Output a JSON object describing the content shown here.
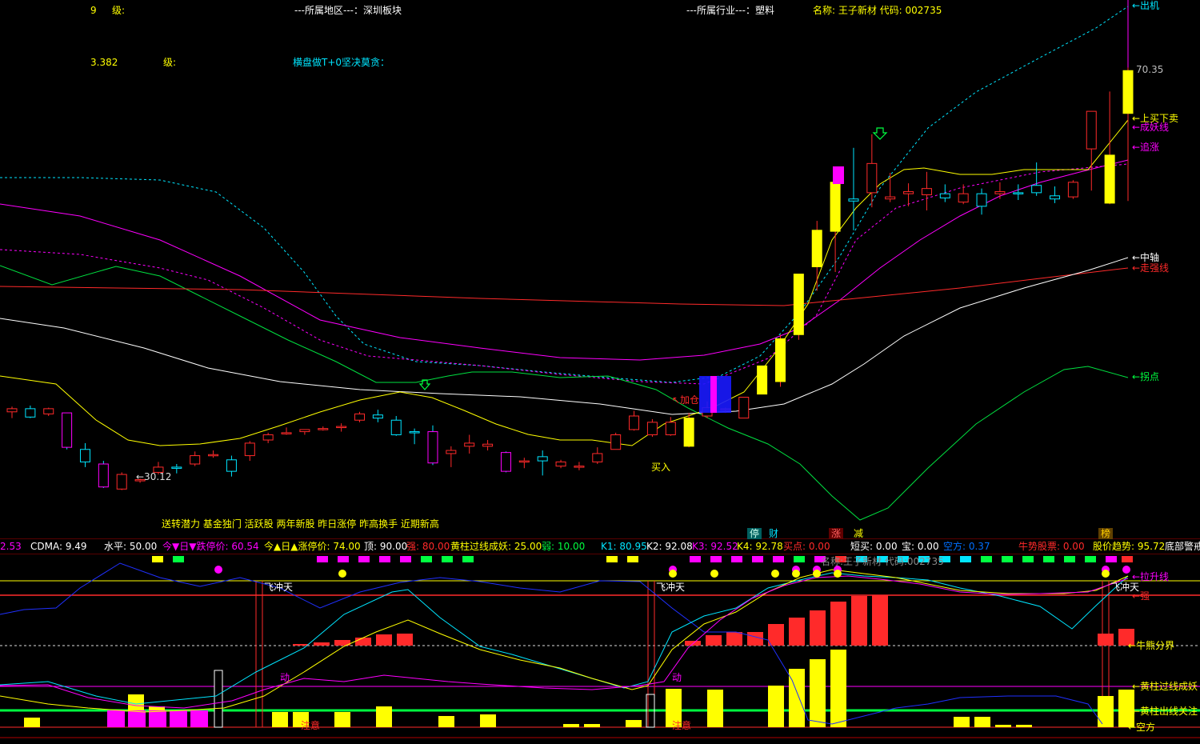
{
  "header": {
    "level1": "9",
    "level1_unit": "级:",
    "region": "---所属地区---：深圳板块",
    "industry": "---所属行业---：塑料",
    "stock_label": "名称: 王子新材 代码: 002735",
    "level2": "3.382",
    "level2_unit": "级:",
    "slogan": "横盘做T+0坚决莫贪："
  },
  "main_price_labels": {
    "high": "70.35",
    "low": "←30.12",
    "buy": "买入",
    "add": "↖加仓",
    "tags": [
      "停",
      "财",
      "涨",
      "减",
      "榜"
    ],
    "bottom_text": "送转潜力 基金独门 活跃股 两年新股 昨日涨停 昨高换手 近期新高"
  },
  "right_labels": [
    {
      "text": "←出机",
      "color": "#00e5ff"
    },
    {
      "text": "←上买下卖",
      "color": "#ffff00"
    },
    {
      "text": "←成妖线",
      "color": "#ff00ff"
    },
    {
      "text": "←追涨",
      "color": "#ff00ff"
    },
    {
      "text": "←中轴",
      "color": "#ffffff"
    },
    {
      "text": "←走强线",
      "color": "#ff2a2a"
    },
    {
      "text": "←拐点",
      "color": "#00ff40"
    }
  ],
  "indicator_bar": [
    {
      "text": "2.53",
      "color": "#ff00ff"
    },
    {
      "text": "CDMA: 9.49",
      "color": "#ffffff"
    },
    {
      "text": "水平: 50.00",
      "color": "#ffffff"
    },
    {
      "text": "今▼日▼跌停价: 60.54",
      "color": "#ff00ff"
    },
    {
      "text": "今▲日▲涨停价: 74.00",
      "color": "#ffff00"
    },
    {
      "text": "顶: 90.00",
      "color": "#ffffff"
    },
    {
      "text": "强: 80.00",
      "color": "#ff2a2a"
    },
    {
      "text": "黄柱过线成妖: 25.00",
      "color": "#ffff00"
    },
    {
      "text": "弱: 10.00",
      "color": "#00ff40"
    },
    {
      "text": "K1: 80.95",
      "color": "#00e5ff"
    },
    {
      "text": "K2: 92.08",
      "color": "#ffffff"
    },
    {
      "text": "K3: 92.52",
      "color": "#ff00ff"
    },
    {
      "text": "K4: 92.78",
      "color": "#ffff00"
    },
    {
      "text": "买点: 0.00",
      "color": "#ff2a2a"
    },
    {
      "text": "短买: 0.00",
      "color": "#ffffff"
    },
    {
      "text": "宝: 0.00",
      "color": "#ffffff"
    },
    {
      "text": "空方: 0.37",
      "color": "#0070ff"
    },
    {
      "text": "牛势股票: 0.00",
      "color": "#ff2a2a"
    },
    {
      "text": "股价趋势: 95.72",
      "color": "#ffff00"
    },
    {
      "text": "底部警戒",
      "color": "#ffffff"
    }
  ],
  "sub_labels": {
    "fly": "飞冲天",
    "move": "动",
    "attention": "注意",
    "overlay": "名称:王子新材 代码:002735",
    "right": [
      {
        "text": "←拉升线",
        "color": "#ff00ff"
      },
      {
        "text": "←强",
        "color": "#ff2a2a"
      },
      {
        "text": "←牛熊分界",
        "color": "#ffff00"
      },
      {
        "text": "←黄柱过线成妖",
        "color": "#ffff00"
      },
      {
        "text": "←黄柱出线关注",
        "color": "#ffff00"
      },
      {
        "text": "←空方",
        "color": "#ffff00"
      }
    ]
  },
  "chart_data": {
    "type": "candlestick",
    "ylim": [
      28,
      74
    ],
    "candles": [
      [
        37.6,
        38.1,
        37.0,
        37.9
      ],
      [
        37.9,
        38.2,
        37.0,
        37.1
      ],
      [
        37.4,
        38.0,
        37.2,
        37.9
      ],
      [
        37.5,
        37.5,
        34.0,
        34.2
      ],
      [
        34.0,
        34.6,
        32.3,
        32.8
      ],
      [
        32.6,
        32.9,
        30.3,
        30.4
      ],
      [
        30.2,
        31.8,
        30.1,
        31.6
      ],
      [
        31.0,
        31.2,
        30.8,
        31.1
      ],
      [
        31.8,
        32.8,
        31.6,
        32.3
      ],
      [
        32.3,
        32.6,
        31.7,
        32.2
      ],
      [
        32.6,
        33.8,
        32.4,
        33.4
      ],
      [
        33.5,
        33.9,
        33.2,
        33.5
      ],
      [
        33.0,
        33.4,
        31.4,
        31.9
      ],
      [
        33.4,
        34.8,
        32.9,
        34.6
      ],
      [
        34.9,
        35.6,
        34.6,
        35.4
      ],
      [
        35.6,
        36.1,
        35.4,
        35.6
      ],
      [
        35.7,
        35.9,
        35.4,
        35.9
      ],
      [
        35.9,
        36.2,
        35.8,
        36.0
      ],
      [
        36.1,
        36.5,
        35.7,
        36.2
      ],
      [
        36.8,
        37.6,
        36.6,
        37.4
      ],
      [
        37.3,
        37.8,
        36.6,
        37.0
      ],
      [
        36.8,
        37.2,
        35.3,
        35.4
      ],
      [
        35.7,
        36.0,
        34.5,
        35.6
      ],
      [
        35.7,
        36.3,
        32.5,
        32.7
      ],
      [
        33.6,
        34.3,
        32.3,
        33.9
      ],
      [
        34.3,
        35.4,
        33.6,
        34.6
      ],
      [
        34.3,
        34.9,
        33.9,
        34.5
      ],
      [
        33.7,
        33.8,
        31.8,
        31.9
      ],
      [
        32.8,
        33.2,
        32.2,
        32.9
      ],
      [
        33.3,
        33.9,
        31.5,
        32.9
      ],
      [
        32.4,
        33.0,
        32.2,
        32.8
      ],
      [
        32.3,
        32.8,
        32.0,
        32.4
      ],
      [
        32.8,
        34.2,
        32.6,
        33.6
      ],
      [
        34.0,
        35.6,
        34.0,
        35.4
      ],
      [
        35.9,
        37.7,
        35.8,
        37.2
      ],
      [
        35.4,
        36.9,
        35.2,
        36.6
      ],
      [
        35.4,
        37.1,
        35.3,
        36.6
      ],
      [
        34.3,
        37.5,
        34.2,
        37.0
      ],
      [
        37.2,
        38.6,
        37.0,
        38.0
      ],
      [
        37.8,
        38.0,
        37.5,
        37.9
      ],
      [
        37.0,
        38.9,
        37.0,
        39.0
      ],
      [
        39.3,
        42.0,
        39.3,
        42.0
      ],
      [
        40.5,
        45.0,
        40.0,
        44.6
      ],
      [
        45.0,
        50.8,
        44.5,
        50.8
      ],
      [
        51.5,
        55.9,
        49.2,
        55.0
      ],
      [
        54.9,
        59.6,
        51.0,
        59.6
      ],
      [
        58.0,
        62.9,
        55.0,
        57.8
      ],
      [
        58.6,
        64.2,
        57.2,
        61.4
      ],
      [
        58.0,
        60.5,
        57.7,
        58.2
      ],
      [
        58.5,
        59.5,
        57.3,
        58.7
      ],
      [
        58.4,
        60.6,
        56.9,
        59.0
      ],
      [
        58.5,
        59.4,
        57.7,
        58.1
      ],
      [
        57.7,
        59.4,
        57.5,
        58.5
      ],
      [
        58.5,
        59.0,
        56.5,
        57.3
      ],
      [
        58.5,
        59.6,
        58.0,
        58.7
      ],
      [
        58.6,
        59.4,
        57.9,
        58.5
      ],
      [
        59.3,
        61.5,
        58.3,
        58.6
      ],
      [
        58.3,
        59.2,
        57.6,
        58.0
      ],
      [
        58.2,
        59.8,
        58.0,
        59.6
      ],
      [
        62.8,
        64.9,
        58.8,
        66.4
      ],
      [
        57.6,
        68.3,
        57.5,
        62.2
      ],
      [
        66.2,
        70.6,
        57.8,
        70.3
      ]
    ]
  }
}
